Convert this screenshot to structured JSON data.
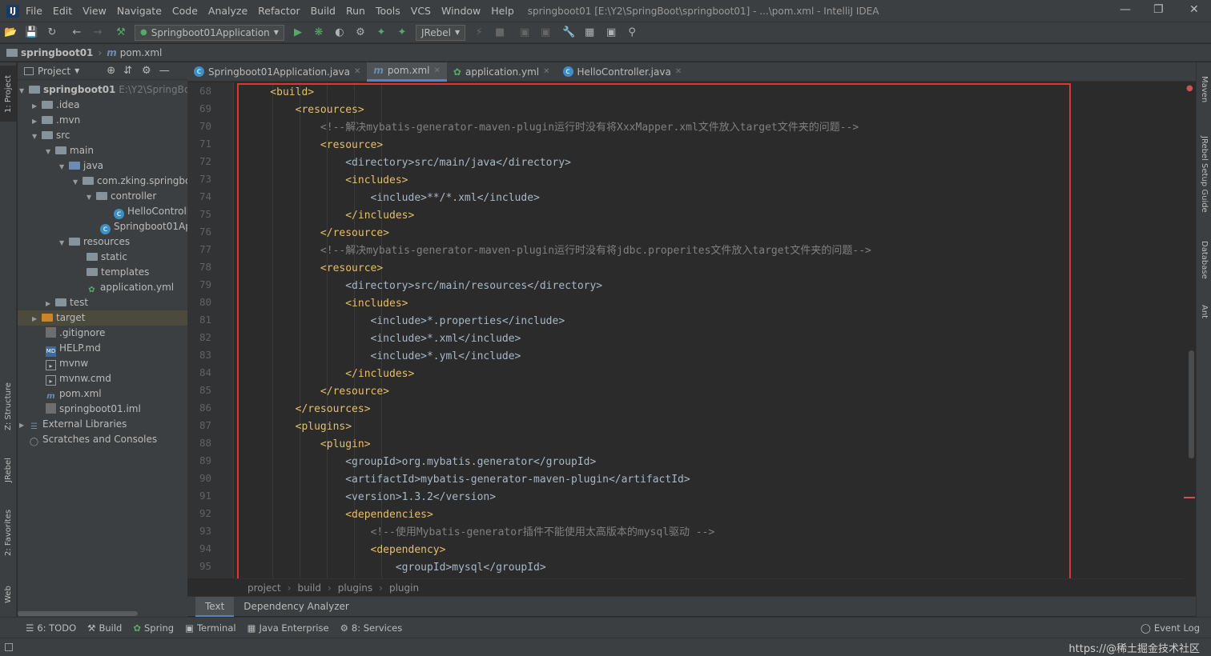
{
  "menubar": {
    "logo": "IJ",
    "items": [
      "File",
      "Edit",
      "View",
      "Navigate",
      "Code",
      "Analyze",
      "Refactor",
      "Build",
      "Run",
      "Tools",
      "VCS",
      "Window",
      "Help"
    ],
    "title": "springboot01 [E:\\Y2\\SpringBoot\\springboot01] - ...\\pom.xml - IntelliJ IDEA"
  },
  "toolbar": {
    "run_config": "Springboot01Application",
    "jrebel": "JRebel"
  },
  "navbar": {
    "project": "springboot01",
    "file": "pom.xml"
  },
  "project_panel": {
    "header": "Project",
    "tree": [
      {
        "label": "springboot01",
        "extra": "E:\\Y2\\SpringBoot"
      },
      {
        "label": ".idea"
      },
      {
        "label": ".mvn"
      },
      {
        "label": "src"
      },
      {
        "label": "main"
      },
      {
        "label": "java"
      },
      {
        "label": "com.zking.springbo"
      },
      {
        "label": "controller"
      },
      {
        "label": "HelloControll"
      },
      {
        "label": "Springboot01Ap"
      },
      {
        "label": "resources"
      },
      {
        "label": "static"
      },
      {
        "label": "templates"
      },
      {
        "label": "application.yml"
      },
      {
        "label": "test"
      },
      {
        "label": "target"
      },
      {
        "label": ".gitignore"
      },
      {
        "label": "HELP.md"
      },
      {
        "label": "mvnw"
      },
      {
        "label": "mvnw.cmd"
      },
      {
        "label": "pom.xml"
      },
      {
        "label": "springboot01.iml"
      },
      {
        "label": "External Libraries"
      },
      {
        "label": "Scratches and Consoles"
      }
    ]
  },
  "tabs": [
    {
      "label": "Springboot01Application.java"
    },
    {
      "label": "pom.xml"
    },
    {
      "label": "application.yml"
    },
    {
      "label": "HelloController.java"
    }
  ],
  "left_stripe": {
    "project": "1: Project",
    "structure": "Z: Structure",
    "jrebel": "JRebel",
    "favorites": "2: Favorites",
    "web": "Web"
  },
  "right_stripe": {
    "maven": "Maven",
    "jrebel_guide": "JRebel Setup Guide",
    "database": "Database",
    "ant": "Ant"
  },
  "editor": {
    "lines": [
      {
        "n": "68",
        "text": "    <build>"
      },
      {
        "n": "69",
        "text": "        <resources>"
      },
      {
        "n": "70",
        "text": "            <!--解决mybatis-generator-maven-plugin运行时没有将XxxMapper.xml文件放入target文件夹的问题-->"
      },
      {
        "n": "71",
        "text": "            <resource>"
      },
      {
        "n": "72",
        "text": "                <directory>src/main/java</directory>"
      },
      {
        "n": "73",
        "text": "                <includes>"
      },
      {
        "n": "74",
        "text": "                    <include>**/*.xml</include>"
      },
      {
        "n": "75",
        "text": "                </includes>"
      },
      {
        "n": "76",
        "text": "            </resource>"
      },
      {
        "n": "77",
        "text": "            <!--解决mybatis-generator-maven-plugin运行时没有将jdbc.properites文件放入target文件夹的问题-->"
      },
      {
        "n": "78",
        "text": "            <resource>"
      },
      {
        "n": "79",
        "text": "                <directory>src/main/resources</directory>"
      },
      {
        "n": "80",
        "text": "                <includes>"
      },
      {
        "n": "81",
        "text": "                    <include>*.properties</include>"
      },
      {
        "n": "82",
        "text": "                    <include>*.xml</include>"
      },
      {
        "n": "83",
        "text": "                    <include>*.yml</include>"
      },
      {
        "n": "84",
        "text": "                </includes>"
      },
      {
        "n": "85",
        "text": "            </resource>"
      },
      {
        "n": "86",
        "text": "        </resources>"
      },
      {
        "n": "87",
        "text": "        <plugins>"
      },
      {
        "n": "88",
        "text": "            <plugin>"
      },
      {
        "n": "89",
        "text": "                <groupId>org.mybatis.generator</groupId>"
      },
      {
        "n": "90",
        "text": "                <artifactId>mybatis-generator-maven-plugin</artifactId>"
      },
      {
        "n": "91",
        "text": "                <version>1.3.2</version>"
      },
      {
        "n": "92",
        "text": "                <dependencies>"
      },
      {
        "n": "93",
        "text": "                    <!--使用Mybatis-generator插件不能使用太高版本的mysql驱动 -->"
      },
      {
        "n": "94",
        "text": "                    <dependency>"
      },
      {
        "n": "95",
        "text": "                        <groupId>mysql</groupId>"
      }
    ]
  },
  "breadcrumb": [
    "project",
    "build",
    "plugins",
    "plugin"
  ],
  "bottom_tabs": [
    "Text",
    "Dependency Analyzer"
  ],
  "tool_windows": [
    "6: TODO",
    "Build",
    "Spring",
    "Terminal",
    "Java Enterprise",
    "8: Services"
  ],
  "status": {
    "event_log": "Event Log",
    "watermark": "https://@稀土掘金技术社区"
  }
}
